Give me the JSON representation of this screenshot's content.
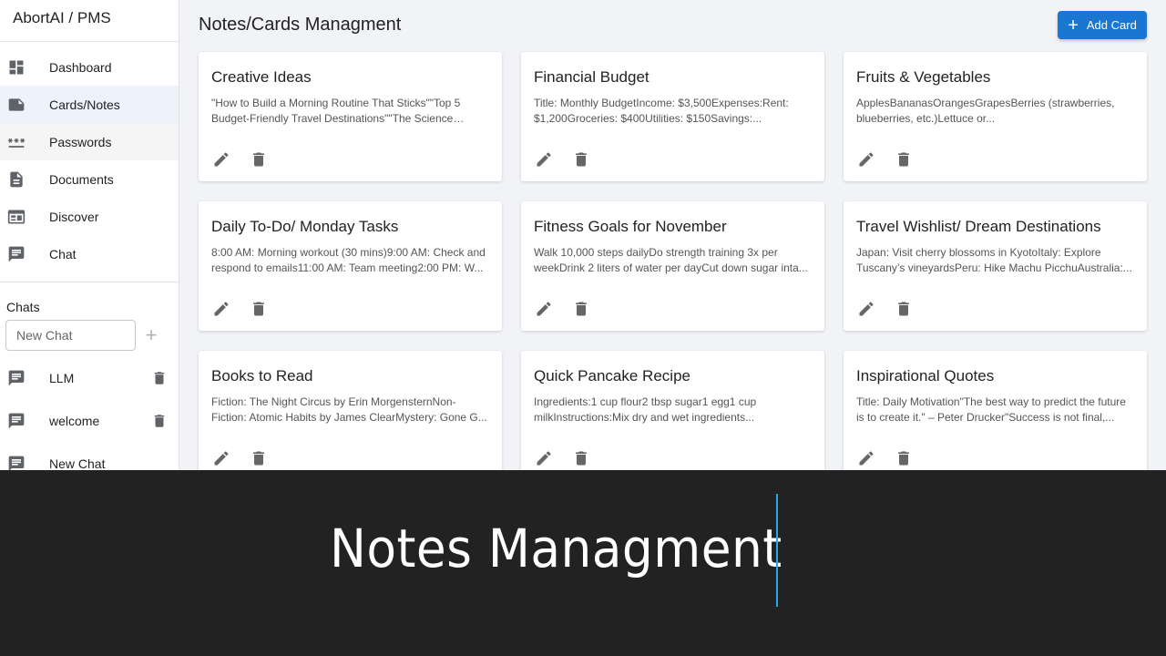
{
  "app": {
    "brand": "AbortAI / PMS"
  },
  "sidebar": {
    "items": [
      {
        "label": "Dashboard",
        "icon": "dashboard-icon"
      },
      {
        "label": "Cards/Notes",
        "icon": "note-icon",
        "selected": true
      },
      {
        "label": "Passwords",
        "icon": "password-icon"
      },
      {
        "label": "Documents",
        "icon": "document-icon"
      },
      {
        "label": "Discover",
        "icon": "discover-icon"
      },
      {
        "label": "Chat",
        "icon": "chat-icon"
      }
    ],
    "chats_heading": "Chats",
    "new_chat_placeholder": "New Chat",
    "chats": [
      {
        "label": "LLM"
      },
      {
        "label": "welcome"
      },
      {
        "label": "New Chat"
      }
    ]
  },
  "main": {
    "title": "Notes/Cards Managment",
    "add_button": "Add Card",
    "add_icon": "+",
    "cards": [
      {
        "title": "Creative Ideas",
        "body": "\"How to Build a Morning Routine That Sticks\"\"Top 5 Budget-Friendly Travel Destinations\"\"The Science Behind..."
      },
      {
        "title": "Financial Budget",
        "body": "Title: Monthly BudgetIncome: $3,500Expenses:Rent: $1,200Groceries: $400Utilities: $150Savings:..."
      },
      {
        "title": "Fruits & Vegetables",
        "body": "ApplesBananasOrangesGrapesBerries (strawberries, blueberries, etc.)Lettuce or..."
      },
      {
        "title": "Daily To-Do/ Monday Tasks",
        "body": "8:00 AM: Morning workout (30 mins)9:00 AM: Check and respond to emails11:00 AM: Team meeting2:00 PM: W..."
      },
      {
        "title": "Fitness Goals for November",
        "body": "Walk 10,000 steps dailyDo strength training 3x per weekDrink 2 liters of water per dayCut down sugar inta..."
      },
      {
        "title": "Travel Wishlist/ Dream Destinations",
        "body": "Japan: Visit cherry blossoms in KyotoItaly: Explore Tuscany’s vineyardsPeru: Hike Machu PicchuAustralia:..."
      },
      {
        "title": "Books to Read",
        "body": "Fiction: The Night Circus by Erin MorgensternNon-Fiction: Atomic Habits by James ClearMystery: Gone G..."
      },
      {
        "title": "Quick Pancake Recipe",
        "body": "Ingredients:1 cup flour2 tbsp sugar1 egg1 cup milkInstructions:Mix dry and wet ingredients..."
      },
      {
        "title": "Inspirational Quotes",
        "body": "Title: Daily Motivation\"The best way to predict the future is to create it.\" – Peter Drucker\"Success is not final,..."
      }
    ]
  },
  "caption": {
    "text": "Notes Managment"
  },
  "colors": {
    "accent": "#1976d2",
    "caption_bg": "#222222",
    "caption_rule": "#29a8e0",
    "main_bg": "#f1f3f6"
  }
}
